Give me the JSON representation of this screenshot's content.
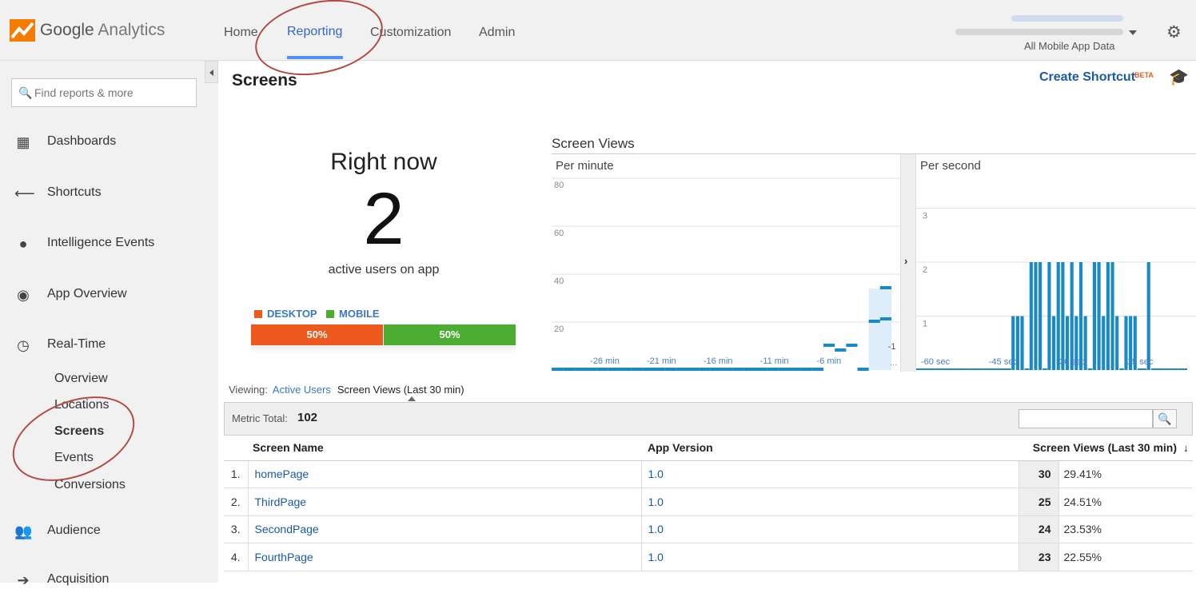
{
  "app": {
    "logo_google": "Google",
    "logo_analytics": "Analytics"
  },
  "nav": {
    "home": "Home",
    "reporting": "Reporting",
    "customization": "Customization",
    "admin": "Admin"
  },
  "account": {
    "view": "All Mobile App Data"
  },
  "sidebar": {
    "search_placeholder": "Find reports & more",
    "items": [
      {
        "label": "Dashboards",
        "icon": "grid-icon"
      },
      {
        "label": "Shortcuts",
        "icon": "shortcut-arrow-icon"
      },
      {
        "label": "Intelligence Events",
        "icon": "lightbulb-icon"
      },
      {
        "label": "App Overview",
        "icon": "target-icon"
      },
      {
        "label": "Real-Time",
        "icon": "clock-icon"
      },
      {
        "label": "Audience",
        "icon": "people-icon"
      },
      {
        "label": "Acquisition",
        "icon": "arrow-right-icon"
      }
    ],
    "realtime_sub": [
      "Overview",
      "Locations",
      "Screens",
      "Events",
      "Conversions"
    ]
  },
  "page": {
    "title": "Screens",
    "create_shortcut": "Create Shortcut",
    "beta": "BETA"
  },
  "realtime": {
    "heading": "Right now",
    "active_users": "2",
    "active_label": "active users on app",
    "legend_desktop": "DESKTOP",
    "legend_mobile": "MOBILE",
    "desktop_pct": "50%",
    "mobile_pct": "50%",
    "colors": {
      "desktop": "#ee5a1d",
      "mobile": "#4cad32"
    }
  },
  "screen_views": {
    "title": "Screen Views",
    "per_minute_label": "Per minute",
    "per_second_label": "Per second",
    "per_minute_y_ticks": [
      "80",
      "60",
      "40",
      "20"
    ],
    "per_minute_x_ticks": [
      "-26 min",
      "-21 min",
      "-16 min",
      "-11 min",
      "-6 min",
      "-1"
    ],
    "per_second_y_ticks": [
      "3",
      "2",
      "1"
    ],
    "per_second_x_ticks": [
      "-60 sec",
      "-45 sec",
      "-30 sec",
      "-15 sec"
    ]
  },
  "chart_data": [
    {
      "type": "bar",
      "title": "Per minute",
      "x": [
        -30,
        -29,
        -28,
        -27,
        -26,
        -25,
        -24,
        -23,
        -22,
        -21,
        -20,
        -19,
        -18,
        -17,
        -16,
        -15,
        -14,
        -13,
        -12,
        -11,
        -10,
        -9,
        -8,
        -7,
        -6,
        -5,
        -4,
        -3,
        -2,
        -1
      ],
      "values": [
        0,
        0,
        0,
        0,
        0,
        0,
        0,
        0,
        0,
        0,
        0,
        0,
        0,
        0,
        0,
        0,
        0,
        0,
        0,
        0,
        0,
        0,
        0,
        0,
        10,
        8,
        10,
        0,
        20,
        21
      ],
      "ylim": [
        0,
        90
      ],
      "ticks_y": [
        20,
        40,
        60,
        80
      ],
      "live_bar": 34
    },
    {
      "type": "bar",
      "title": "Per second",
      "x": [
        -60,
        -59,
        -58,
        -57,
        -56,
        -55,
        -54,
        -53,
        -52,
        -51,
        -50,
        -49,
        -48,
        -47,
        -46,
        -45,
        -44,
        -43,
        -42,
        -41,
        -40,
        -39,
        -38,
        -37,
        -36,
        -35,
        -34,
        -33,
        -32,
        -31,
        -30,
        -29,
        -28,
        -27,
        -26,
        -25,
        -24,
        -23,
        -22,
        -21,
        -20,
        -19,
        -18,
        -17,
        -16,
        -15,
        -14,
        -13,
        -12,
        -11,
        -10,
        -9,
        -8,
        -7,
        -6,
        -5,
        -4,
        -3,
        -2,
        -1
      ],
      "values": [
        0,
        0,
        0,
        0,
        0,
        0,
        0,
        0,
        0,
        0,
        0,
        0,
        0,
        0,
        0,
        0,
        0,
        0,
        0,
        0,
        0,
        1,
        1,
        1,
        0,
        2,
        2,
        2,
        0,
        2,
        1,
        2,
        2,
        1,
        2,
        1,
        2,
        1,
        0,
        2,
        2,
        1,
        2,
        2,
        1,
        0,
        1,
        1,
        1,
        0,
        0,
        2,
        0,
        0,
        0,
        0,
        0,
        0,
        0,
        0
      ],
      "ylim": [
        0,
        4
      ],
      "ticks_y": [
        1,
        2,
        3
      ]
    }
  ],
  "viewing": {
    "label": "Viewing:",
    "active_users": "Active Users",
    "current": "Screen Views (Last 30 min)"
  },
  "metric": {
    "label": "Metric Total:",
    "value": "102"
  },
  "table": {
    "headers": [
      "Screen Name",
      "App Version",
      "Screen Views (Last 30 min)"
    ],
    "rows": [
      {
        "idx": "1.",
        "name": "homePage",
        "version": "1.0",
        "views": "30",
        "pct": "29.41%"
      },
      {
        "idx": "2.",
        "name": "ThirdPage",
        "version": "1.0",
        "views": "25",
        "pct": "24.51%"
      },
      {
        "idx": "3.",
        "name": "SecondPage",
        "version": "1.0",
        "views": "24",
        "pct": "23.53%"
      },
      {
        "idx": "4.",
        "name": "FourthPage",
        "version": "1.0",
        "views": "23",
        "pct": "22.55%"
      }
    ]
  }
}
